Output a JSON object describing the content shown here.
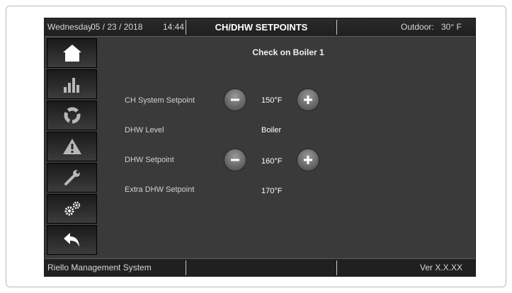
{
  "header": {
    "day": "Wednesday",
    "date": "05 / 23 / 2018",
    "time": "14:44",
    "title": "CH/DHW SETPOINTS",
    "outdoor_label": "Outdoor:",
    "outdoor_value": "30° F"
  },
  "sidebar": {
    "items": [
      {
        "icon": "home-icon"
      },
      {
        "icon": "bar-chart-icon"
      },
      {
        "icon": "cycle-icon"
      },
      {
        "icon": "warning-icon"
      },
      {
        "icon": "wrench-icon"
      },
      {
        "icon": "gears-icon"
      },
      {
        "icon": "back-arrow-icon"
      }
    ]
  },
  "main": {
    "heading": "Check on Boiler 1",
    "rows": [
      {
        "label": "CH System Setpoint",
        "value": "150°F",
        "adjustable": true
      },
      {
        "label": "DHW Level",
        "value": "Boiler",
        "adjustable": false
      },
      {
        "label": "DHW Setpoint",
        "value": "160°F",
        "adjustable": true
      },
      {
        "label": "Extra DHW Setpoint",
        "value": "170°F",
        "adjustable": false
      }
    ]
  },
  "footer": {
    "system_name": "Riello Management System",
    "version": "Ver X.X.XX"
  },
  "colors": {
    "screen_bg": "#3a3a3a",
    "bar_bg": "#202020",
    "text": "#ffffff"
  }
}
